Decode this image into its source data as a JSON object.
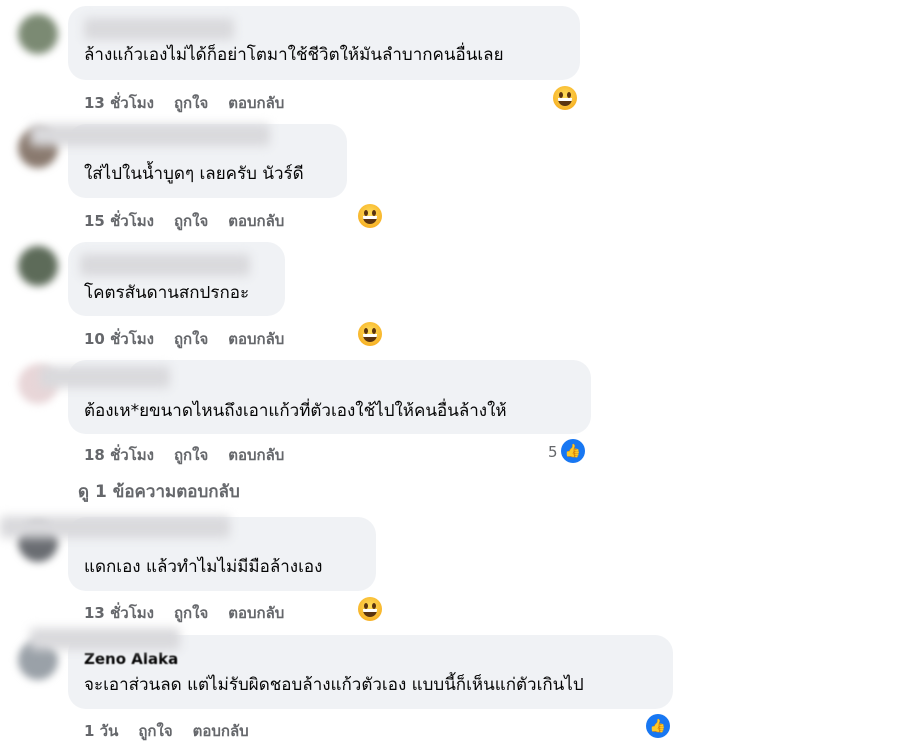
{
  "comments": [
    {
      "text": "ล้างแก้วเองไม่ได้ก็อย่าโตมาใช้ชีวิตให้มันลำบากคนอื่นเลย",
      "time": "13 ชั่วโมง",
      "like": "ถูกใจ",
      "reply": "ตอบกลับ",
      "reaction": "haha-emoji"
    },
    {
      "text": "ใส่ไปในน้ำบูดๆ เลยครับ นัวร์ดี",
      "time": "15 ชั่วโมง",
      "like": "ถูกใจ",
      "reply": "ตอบกลับ",
      "reaction": "haha-emoji"
    },
    {
      "text": "โคตรสันดานสกปรกอะ",
      "time": "10 ชั่วโมง",
      "like": "ถูกใจ",
      "reply": "ตอบกลับ",
      "reaction": "haha-emoji"
    },
    {
      "text": "ต้องเห*ยขนาดไหนถึงเอาแก้วที่ตัวเองใช้ไปให้คนอื่นล้างให้",
      "time": "18 ชั่วโมง",
      "like": "ถูกใจ",
      "reply": "ตอบกลับ",
      "reaction": "like-icon",
      "reaction_count": "5"
    },
    {
      "text": "แดกเอง แล้วทำไมไม่มีมือล้างเอง",
      "time": "13 ชั่วโมง",
      "like": "ถูกใจ",
      "reply": "ตอบกลับ",
      "reaction": "haha-emoji"
    },
    {
      "name": "Zeno Alaka",
      "text": "จะเอาส่วนลด แต่ไม่รับผิดชอบล้างแก้วตัวเอง แบบนี้ก็เห็นแก่ตัวเกินไป",
      "time": "1 วัน",
      "like": "ถูกใจ",
      "reply": "ตอบกลับ",
      "reaction": "like-icon"
    }
  ],
  "view_replies": "ดู 1 ข้อความตอบกลับ",
  "colors": {
    "bubble": "#f0f2f5",
    "meta": "#65676b",
    "like_blue": "#1877f2",
    "haha_yellow": "#f7b125"
  }
}
